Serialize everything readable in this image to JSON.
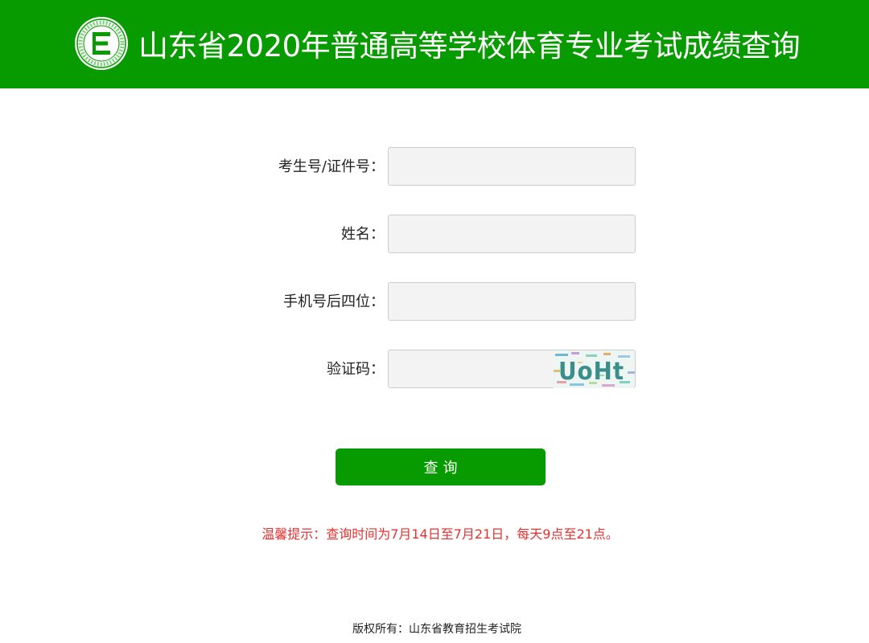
{
  "header": {
    "title": "山东省2020年普通高等学校体育专业考试成绩查询",
    "logo_icon": "education-admission-emblem-icon",
    "brand_color": "#079b00"
  },
  "form": {
    "fields": [
      {
        "label": "考生号/证件号：",
        "value": "",
        "placeholder": ""
      },
      {
        "label": "姓名：",
        "value": "",
        "placeholder": ""
      },
      {
        "label": "手机号后四位：",
        "value": "",
        "placeholder": ""
      },
      {
        "label": "验证码：",
        "value": "",
        "placeholder": ""
      }
    ],
    "captcha_text": "UoHt",
    "submit_label": "查询"
  },
  "notice": {
    "text": "温馨提示：查询时间为7月14日至7月21日，每天9点至21点。",
    "color": "#e53130"
  },
  "footer": {
    "copyright": "版权所有：山东省教育招生考试院"
  }
}
